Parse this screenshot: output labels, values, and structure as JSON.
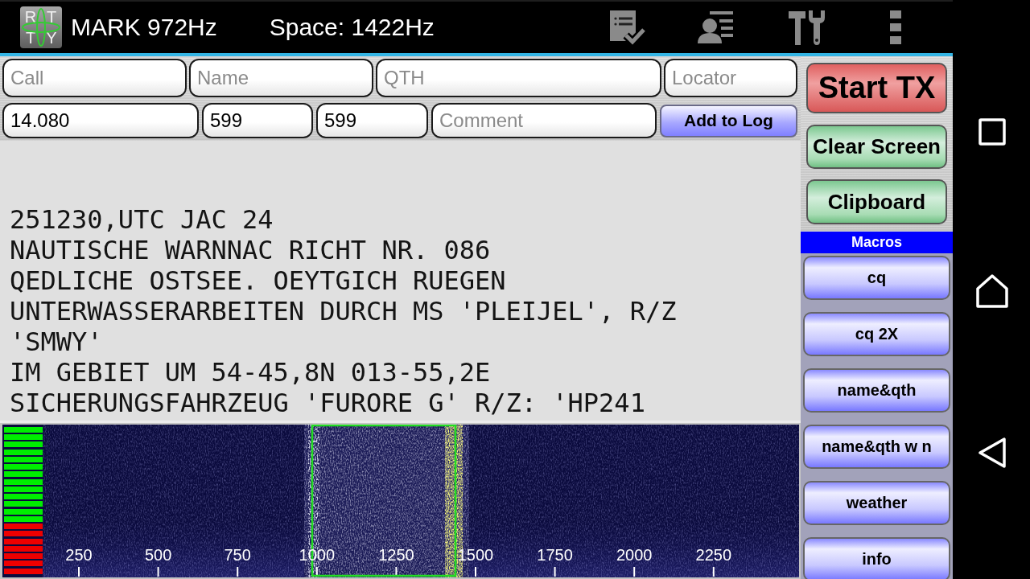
{
  "app_bar": {
    "logo_letters": [
      "R",
      "T",
      "T",
      "Y"
    ],
    "mark": "MARK 972Hz",
    "space": "Space: 1422Hz"
  },
  "log_form": {
    "rows": [
      [
        {
          "placeholder": "Call"
        },
        {
          "placeholder": "Name"
        },
        {
          "placeholder": "QTH"
        },
        {
          "placeholder": "Locator"
        }
      ],
      [
        {
          "value": "14.080"
        },
        {
          "value": "599"
        },
        {
          "value": "599"
        },
        {
          "placeholder": "Comment"
        }
      ]
    ],
    "add_button": "Add to Log"
  },
  "received_text": [
    "251230,UTC JAC 24",
    "NAUTISCHE WARNNAC RICHT NR. 086",
    "QEDLICHE OSTSEE. OEYTGICH RUEGEN",
    "UNTERWASSERARBEITEN DURCH MS 'PLEIJEL', R/Z",
    "'SMWY'",
    "IM GEBIET UM 54-45,8N 013-55,2E",
    "SICHERUNGSFAHRZEUG 'FURORE G' R/Z: 'HP241"
  ],
  "waterfall": {
    "meter": {
      "level": 0.65
    },
    "scale": [
      "250",
      "500",
      "750",
      "1000",
      "1250",
      "1500",
      "1750",
      "2000",
      "2250"
    ]
  },
  "controls": [
    {
      "kind": "transmit",
      "label": "Start TX"
    },
    {
      "kind": "command",
      "label": "Clear Screen"
    },
    {
      "kind": "command",
      "label": "Clipboard"
    }
  ],
  "macros": {
    "title": "Macros",
    "buttons": [
      "cq",
      "cq 2X",
      "name&qth",
      "name&qth w n",
      "weather",
      "info"
    ]
  }
}
